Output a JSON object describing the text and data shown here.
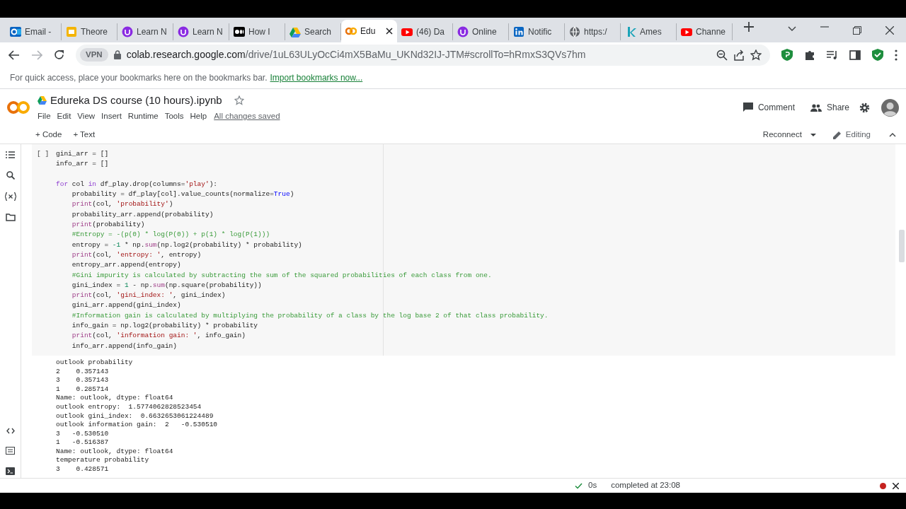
{
  "browser": {
    "tabs": [
      {
        "label": "Email -",
        "selected": false
      },
      {
        "label": "Theore",
        "selected": false
      },
      {
        "label": "Learn N",
        "selected": false
      },
      {
        "label": "Learn N",
        "selected": false
      },
      {
        "label": "How I",
        "selected": false
      },
      {
        "label": "Search",
        "selected": false
      },
      {
        "label": "Edu",
        "selected": true
      },
      {
        "label": "(46) Da",
        "selected": false
      },
      {
        "label": "Online",
        "selected": false
      },
      {
        "label": "Notific",
        "selected": false
      },
      {
        "label": "https:/",
        "selected": false
      },
      {
        "label": "Ames",
        "selected": false
      },
      {
        "label": "Channe",
        "selected": false
      }
    ],
    "address": {
      "vpn": "VPN",
      "host": "colab.research.google.com",
      "path": "/drive/1uL63ULyOcCi4mX5BaMu_UKNd32IJ-JTM#scrollTo=hRmxS3QVs7hm"
    },
    "bookmarks_bar": {
      "message": "For quick access, place your bookmarks here on the bookmarks bar.",
      "link": "Import bookmarks now..."
    }
  },
  "notebook": {
    "title": "Edureka DS course (10 hours).ipynb",
    "menu": [
      "File",
      "Edit",
      "View",
      "Insert",
      "Runtime",
      "Tools",
      "Help"
    ],
    "save_status": "All changes saved",
    "comment": "Comment",
    "share": "Share",
    "toolbar": {
      "add_code": "+ Code",
      "add_text": "+ Text",
      "connect": "Reconnect",
      "mode": "Editing"
    },
    "cell": {
      "run_marker": "[ ]",
      "lines": [
        {
          "kind": "code",
          "indented": false,
          "segments": [
            {
              "kind": "plain",
              "text": "gini_arr = []"
            }
          ]
        },
        {
          "kind": "code",
          "indented": false,
          "segments": [
            {
              "kind": "plain",
              "text": "info_arr = []"
            }
          ]
        },
        {
          "kind": "blank"
        },
        {
          "kind": "code",
          "indented": false,
          "segments": [
            {
              "kind": "keyword",
              "text": "for"
            },
            {
              "kind": "plain",
              "text": " col "
            },
            {
              "kind": "keyword",
              "text": "in"
            },
            {
              "kind": "plain",
              "text": " df_play.drop(columns="
            },
            {
              "kind": "string",
              "text": "'play'"
            },
            {
              "kind": "plain",
              "text": "):"
            }
          ]
        },
        {
          "kind": "code",
          "indented": true,
          "segments": [
            {
              "kind": "plain",
              "text": "probability = df_play[col].value_counts(normalize="
            },
            {
              "kind": "literal",
              "text": "True"
            },
            {
              "kind": "plain",
              "text": ")"
            }
          ]
        },
        {
          "kind": "code",
          "indented": true,
          "segments": [
            {
              "kind": "builtin",
              "text": "print"
            },
            {
              "kind": "plain",
              "text": "(col, "
            },
            {
              "kind": "string",
              "text": "'probability'"
            },
            {
              "kind": "plain",
              "text": ")"
            }
          ]
        },
        {
          "kind": "code",
          "indented": true,
          "segments": [
            {
              "kind": "plain",
              "text": "probability_arr.append(probability)"
            }
          ]
        },
        {
          "kind": "code",
          "indented": true,
          "segments": [
            {
              "kind": "builtin",
              "text": "print"
            },
            {
              "kind": "plain",
              "text": "(probability)"
            }
          ]
        },
        {
          "kind": "code",
          "indented": true,
          "segments": [
            {
              "kind": "comment",
              "text": "#Entropy = -(p(0) * log(P(0)) + p(1) * log(P(1)))"
            }
          ]
        },
        {
          "kind": "code",
          "indented": true,
          "segments": [
            {
              "kind": "plain",
              "text": "entropy = "
            },
            {
              "kind": "number",
              "text": "-1"
            },
            {
              "kind": "plain",
              "text": " * np."
            },
            {
              "kind": "builtin",
              "text": "sum"
            },
            {
              "kind": "plain",
              "text": "(np.log2(probability) * probability)"
            }
          ]
        },
        {
          "kind": "code",
          "indented": true,
          "segments": [
            {
              "kind": "builtin",
              "text": "print"
            },
            {
              "kind": "plain",
              "text": "(col, "
            },
            {
              "kind": "string",
              "text": "'entropy: '"
            },
            {
              "kind": "plain",
              "text": ", entropy)"
            }
          ]
        },
        {
          "kind": "code",
          "indented": true,
          "segments": [
            {
              "kind": "plain",
              "text": "entropy_arr.append(entropy)"
            }
          ]
        },
        {
          "kind": "code",
          "indented": true,
          "segments": [
            {
              "kind": "comment",
              "text": "#Gini impurity is calculated by subtracting the sum of the squared probabilities of each class from one."
            }
          ]
        },
        {
          "kind": "code",
          "indented": true,
          "segments": [
            {
              "kind": "plain",
              "text": "gini_index = "
            },
            {
              "kind": "number",
              "text": "1"
            },
            {
              "kind": "plain",
              "text": " - np."
            },
            {
              "kind": "builtin",
              "text": "sum"
            },
            {
              "kind": "plain",
              "text": "(np.square(probability))"
            }
          ]
        },
        {
          "kind": "code",
          "indented": true,
          "segments": [
            {
              "kind": "builtin",
              "text": "print"
            },
            {
              "kind": "plain",
              "text": "(col, "
            },
            {
              "kind": "string",
              "text": "'gini_index: '"
            },
            {
              "kind": "plain",
              "text": ", gini_index)"
            }
          ]
        },
        {
          "kind": "code",
          "indented": true,
          "segments": [
            {
              "kind": "plain",
              "text": "gini_arr.append(gini_index)"
            }
          ]
        },
        {
          "kind": "code",
          "indented": true,
          "segments": [
            {
              "kind": "comment",
              "text": "#Information gain is calculated by multiplying the probability of a class by the log base 2 of that class probability."
            }
          ]
        },
        {
          "kind": "code",
          "indented": true,
          "segments": [
            {
              "kind": "plain",
              "text": "info_gain = np.log2(probability) * probability"
            }
          ]
        },
        {
          "kind": "code",
          "indented": true,
          "segments": [
            {
              "kind": "builtin",
              "text": "print"
            },
            {
              "kind": "plain",
              "text": "(col, "
            },
            {
              "kind": "string",
              "text": "'information gain: '"
            },
            {
              "kind": "plain",
              "text": ", info_gain)"
            }
          ]
        },
        {
          "kind": "code",
          "indented": true,
          "segments": [
            {
              "kind": "plain",
              "text": "info_arr.append(info_gain)"
            }
          ]
        }
      ]
    },
    "output": [
      "outlook probability",
      "2    0.357143",
      "3    0.357143",
      "1    0.285714",
      "Name: outlook, dtype: float64",
      "outlook entropy:  1.5774062828523454",
      "outlook gini_index:  0.6632653061224489",
      "outlook information gain:  2   -0.530510",
      "3   -0.530510",
      "1   -0.516387",
      "Name: outlook, dtype: float64",
      "temperature probability",
      "3    0.428571"
    ]
  },
  "status_bar": {
    "elapsed": "0s",
    "message": "completed at 23:08"
  }
}
